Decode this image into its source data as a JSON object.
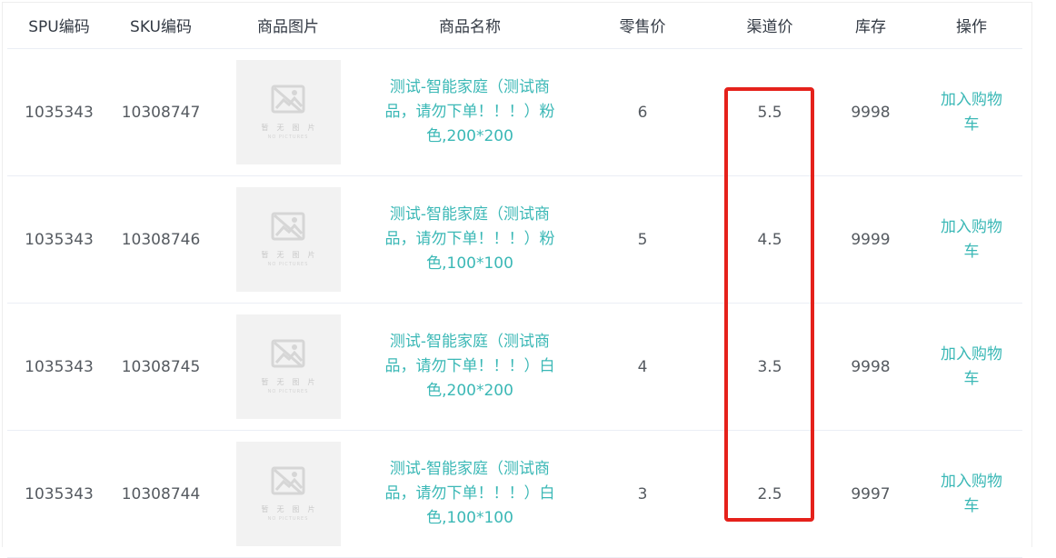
{
  "columns": {
    "spu": "SPU编码",
    "sku": "SKU编码",
    "image": "商品图片",
    "name": "商品名称",
    "retail_price": "零售价",
    "channel_price": "渠道价",
    "stock": "库存",
    "action": "操作"
  },
  "placeholder_image": {
    "text_cn": "暂无图片",
    "text_en": "NO PICTURES",
    "icon": "broken-image-icon"
  },
  "rows": [
    {
      "spu": "1035343",
      "sku": "10308747",
      "name": "测试-智能家庭（测试商品，请勿下单！！！）粉色,200*200",
      "retail_price": "6",
      "channel_price": "5.5",
      "stock": "9998",
      "action": "加入购物车"
    },
    {
      "spu": "1035343",
      "sku": "10308746",
      "name": "测试-智能家庭（测试商品，请勿下单！！！）粉色,100*100",
      "retail_price": "5",
      "channel_price": "4.5",
      "stock": "9999",
      "action": "加入购物车"
    },
    {
      "spu": "1035343",
      "sku": "10308745",
      "name": "测试-智能家庭（测试商品，请勿下单！！！）白色,200*200",
      "retail_price": "4",
      "channel_price": "3.5",
      "stock": "9998",
      "action": "加入购物车"
    },
    {
      "spu": "1035343",
      "sku": "10308744",
      "name": "测试-智能家庭（测试商品，请勿下单！！！）白色,100*100",
      "retail_price": "3",
      "channel_price": "2.5",
      "stock": "9997",
      "action": "加入购物车"
    }
  ],
  "colors": {
    "link": "#3bb8b6",
    "highlight": "#e5211b",
    "text": "#555a60"
  }
}
